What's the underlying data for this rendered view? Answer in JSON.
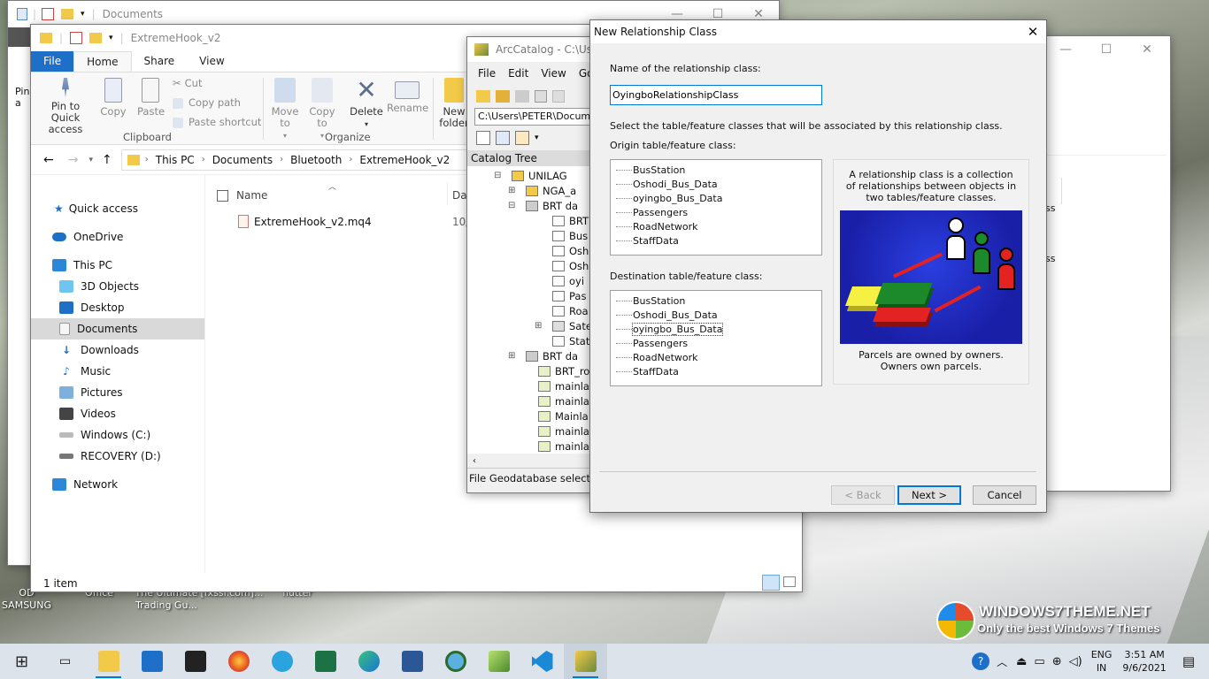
{
  "desktop": {
    "icons": [
      "OD\nSAMSUNG",
      "Office",
      "The Ultimate\nTrading Gu...",
      "[fxssi.com]...",
      "flutter"
    ],
    "watermark_title": "WINDOWS7THEME.NET",
    "watermark_sub": "Only the best Windows 7 Themes",
    "left_partial": "15"
  },
  "back_window": {
    "title": "Documents"
  },
  "explorer": {
    "title": "ExtremeHook_v2",
    "tabs": [
      "File",
      "Home",
      "Share",
      "View"
    ],
    "ribbon": {
      "pin": "Pin to Quick access",
      "copy": "Copy",
      "paste": "Paste",
      "cut": "Cut",
      "copy_path": "Copy path",
      "paste_shortcut": "Paste shortcut",
      "clipboard": "Clipboard",
      "move_to": "Move to",
      "copy_to": "Copy to",
      "delete": "Delete",
      "rename": "Rename",
      "organize": "Organize",
      "new_folder": "New folder"
    },
    "breadcrumb": [
      "This PC",
      "Documents",
      "Bluetooth",
      "ExtremeHook_v2"
    ],
    "column_name": "Name",
    "column_date_partial": "Dat",
    "file_name": "ExtremeHook_v2.mq4",
    "file_date_partial": "10/",
    "nav": {
      "quick_access": "Quick access",
      "onedrive": "OneDrive",
      "this_pc": "This PC",
      "objects3d": "3D Objects",
      "desktop": "Desktop",
      "documents": "Documents",
      "downloads": "Downloads",
      "music": "Music",
      "pictures": "Pictures",
      "videos": "Videos",
      "windows_c": "Windows (C:)",
      "recovery_d": "RECOVERY (D:)",
      "network": "Network"
    },
    "status": "1 item",
    "left_partial": "Pin\na"
  },
  "arccatalog": {
    "title": "ArcCatalog - C:\\Users",
    "menu": [
      "File",
      "Edit",
      "View",
      "Go"
    ],
    "location": "C:\\Users\\PETER\\Docume",
    "tree_title": "Catalog Tree",
    "tree": [
      {
        "label": "UNILAG"
      },
      {
        "label": "NGA_a"
      },
      {
        "label": "BRT da"
      },
      {
        "label": "BRT"
      },
      {
        "label": "Bus"
      },
      {
        "label": "Osh"
      },
      {
        "label": "Osh"
      },
      {
        "label": "oyi"
      },
      {
        "label": "Pas"
      },
      {
        "label": "Roa"
      },
      {
        "label": "Sate"
      },
      {
        "label": "Stat"
      },
      {
        "label": "BRT da"
      },
      {
        "label": "BRT_ro"
      },
      {
        "label": "mainla"
      },
      {
        "label": "mainla"
      },
      {
        "label": "Mainla"
      },
      {
        "label": "mainla"
      },
      {
        "label": "mainla"
      }
    ],
    "status": "File Geodatabase selected"
  },
  "right_window": {
    "partials": [
      "ss",
      "ss"
    ]
  },
  "dialog": {
    "title": "New Relationship Class",
    "name_label": "Name of the relationship class:",
    "name_value": "OyingboRelationshipClass",
    "select_label": "Select the table/feature classes that will be associated by this relationship class.",
    "origin_label": "Origin table/feature class:",
    "origin_items": [
      "BusStation",
      "Oshodi_Bus_Data",
      "oyingbo_Bus_Data",
      "Passengers",
      "RoadNetwork",
      "StaffData"
    ],
    "dest_label": "Destination table/feature class:",
    "dest_items": [
      "BusStation",
      "Oshodi_Bus_Data",
      "oyingbo_Bus_Data",
      "Passengers",
      "RoadNetwork",
      "StaffData"
    ],
    "info_text": "A relationship class is a collection of relationships between objects in two tables/feature classes.",
    "caption": "Parcels are owned by owners.\nOwners own parcels.",
    "back": "< Back",
    "next": "Next >",
    "cancel": "Cancel"
  },
  "taskbar": {
    "time": "3:51 AM",
    "date": "9/6/2021",
    "lang1": "ENG",
    "lang2": "IN"
  }
}
